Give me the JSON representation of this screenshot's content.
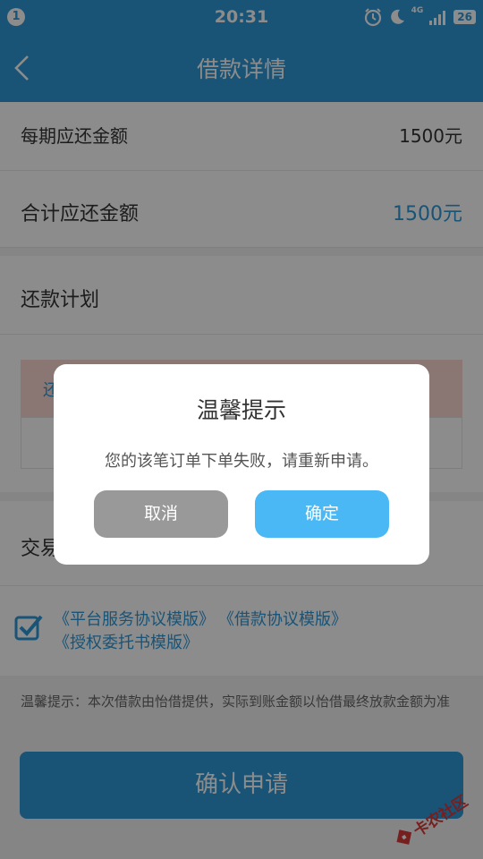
{
  "status_bar": {
    "notification_count": "1",
    "time": "20:31",
    "network": "4G",
    "battery": "26",
    "icons": [
      "alarm-icon",
      "moon-icon",
      "signal-icon"
    ]
  },
  "nav": {
    "title": "借款详情",
    "back_icon": "chevron-left-icon"
  },
  "page": {
    "per_period_label": "每期应还金额",
    "per_period_value": "1500元",
    "total_label": "合计应还金额",
    "total_value": "1500元",
    "plan_label": "还款计划",
    "table_header_partial": "还",
    "transaction_label_partial": "交易",
    "agreements": [
      "《平台服务协议模版》",
      "《借款协议模版》",
      "《授权委托书模版》"
    ],
    "notice": "温馨提示：本次借款由怡借提供，实际到账金额以怡借最终放款金额为准",
    "confirm_button": "确认申请"
  },
  "dialog": {
    "title": "温馨提示",
    "message": "您的该笔订单下单失败，请重新申请。",
    "cancel_button": "取消",
    "ok_button": "确定"
  },
  "watermark": {
    "text": "卡农社区"
  },
  "colors": {
    "primary": "#2f97d8",
    "dialog_ok": "#49b8f5",
    "dialog_cancel": "#999999",
    "total_value": "#2f97d8",
    "table_header": "#fbd9d2"
  }
}
